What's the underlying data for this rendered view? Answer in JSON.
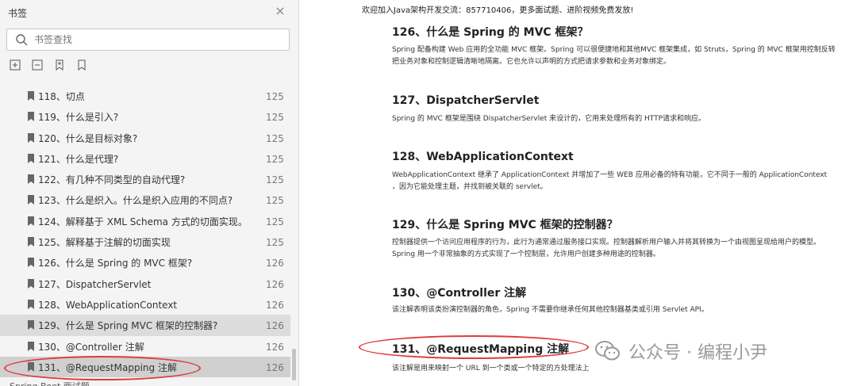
{
  "sidebar": {
    "title": "书签",
    "search_placeholder": "书签查找",
    "items": [
      {
        "label": "118、切点",
        "page": "125"
      },
      {
        "label": "119、什么是引入?",
        "page": "125"
      },
      {
        "label": "120、什么是目标对象?",
        "page": "125"
      },
      {
        "label": "121、什么是代理?",
        "page": "125"
      },
      {
        "label": "122、有几种不同类型的自动代理?",
        "page": "125"
      },
      {
        "label": "123、什么是织入。什么是织入应用的不同点?",
        "page": "125"
      },
      {
        "label": "124、解释基于 XML Schema 方式的切面实现。",
        "page": "125"
      },
      {
        "label": "125、解释基于注解的切面实现",
        "page": "125"
      },
      {
        "label": "126、什么是 Spring 的 MVC 框架?",
        "page": "126"
      },
      {
        "label": "127、DispatcherServlet",
        "page": "126"
      },
      {
        "label": "128、WebApplicationContext",
        "page": "126"
      },
      {
        "label": "129、什么是 Spring MVC 框架的控制器?",
        "page": "126"
      },
      {
        "label": "130、@Controller 注解",
        "page": "126"
      },
      {
        "label": "131、@RequestMapping 注解",
        "page": "126"
      }
    ],
    "cut_off_label": "Spring Boot 面试题"
  },
  "doc": {
    "banner": "欢迎加入Java架构开发交流：857710406，更多面试题、进阶视频免费发放!",
    "sections": [
      {
        "heading": "126、什么是 Spring 的 MVC 框架？",
        "body": "Spring 配备构建 Web 应用的全功能 MVC 框架。Spring 可以很便捷地和其他MVC 框架集成，如 Struts，Spring 的 MVC 框架用控制反转把业务对象和控制逻辑清晰地隔离。它也允许以声明的方式把请求参数和业务对象绑定。"
      },
      {
        "heading": "127、DispatcherServlet",
        "body": "Spring 的 MVC 框架是围绕 DispatcherServlet 来设计的，它用来处理所有的 HTTP请求和响应。"
      },
      {
        "heading": "128、WebApplicationContext",
        "body": "WebApplicationContext 继承了 ApplicationContext 并增加了一些 WEB 应用必备的特有功能，它不同于一般的 ApplicationContext ，因为它能处理主题，并找到被关联的 servlet。"
      },
      {
        "heading": "129、什么是 Spring MVC 框架的控制器？",
        "body": "控制器提供一个访问应用程序的行为，此行为通常通过服务接口实现。控制器解析用户输入并将其转换为一个由视图呈现给用户的模型。Spring 用一个非常抽象的方式实现了一个控制层，允许用户创建多种用途的控制器。"
      },
      {
        "heading": "130、@Controller 注解",
        "body": "该注解表明该类扮演控制器的角色，Spring 不需要你继承任何其他控制器基类或引用 Servlet API。"
      },
      {
        "heading": "131、@RequestMapping 注解",
        "body": "该注解是用来映射一个 URL 到一个类或一个特定的方处理法上"
      }
    ],
    "watermark": "公众号 · 编程小尹"
  },
  "colors": {
    "annotation": "#e03a3a",
    "sidebar_bg": "#f4f4f4",
    "highlight": "#dcdcdc"
  }
}
